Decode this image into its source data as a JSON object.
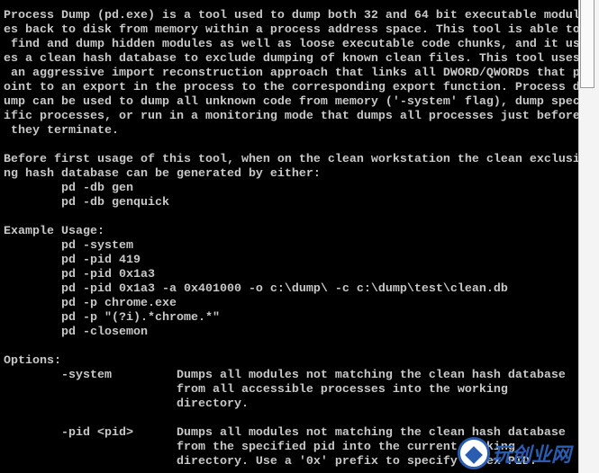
{
  "console": {
    "lines": [
      "Process Dump (pd.exe) is a tool used to dump both 32 and 64 bit executable modul",
      "es back to disk from memory within a process address space. This tool is able to",
      " find and dump hidden modules as well as loose executable code chunks, and it us",
      "es a clean hash database to exclude dumping of known clean files. This tool uses",
      " an aggressive import reconstruction approach that links all DWORD/QWORDs that p",
      "oint to an export in the process to the corresponding export function. Process d",
      "ump can be used to dump all unknown code from memory ('-system' flag), dump spec",
      "ific processes, or run in a monitoring mode that dumps all processes just before",
      " they terminate.",
      "",
      "Before first usage of this tool, when on the clean workstation the clean exclusi",
      "ng hash database can be generated by either:",
      "        pd -db gen",
      "        pd -db genquick",
      "",
      "Example Usage:",
      "        pd -system",
      "        pd -pid 419",
      "        pd -pid 0x1a3",
      "        pd -pid 0x1a3 -a 0x401000 -o c:\\dump\\ -c c:\\dump\\test\\clean.db",
      "        pd -p chrome.exe",
      "        pd -p \"(?i).*chrome.*\"",
      "        pd -closemon",
      "",
      "Options:",
      "        -system         Dumps all modules not matching the clean hash database",
      "                        from all accessible processes into the working",
      "                        directory.",
      "",
      "        -pid <pid>      Dumps all modules not matching the clean hash database",
      "                        from the specified pid into the current working",
      "                        directory. Use a '0x' prefix to specify a hex PID."
    ]
  },
  "watermark": {
    "text": "玩创业网",
    "color": "#2a5db0"
  },
  "colors": {
    "background": "#000000",
    "text": "#c8c8c8"
  }
}
